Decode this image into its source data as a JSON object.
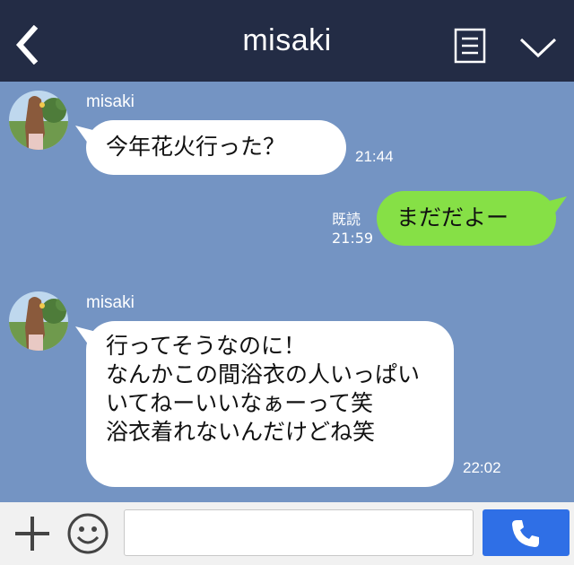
{
  "header": {
    "title": "misaki",
    "back_icon": "chevron-left-icon",
    "notes_icon": "note-icon",
    "menu_icon": "chevron-down-icon"
  },
  "messages": [
    {
      "direction": "in",
      "sender": "misaki",
      "text": "今年花火行った？",
      "time": "21:44"
    },
    {
      "direction": "out",
      "text": "まだだよー",
      "read_label": "既読",
      "time": "21:59"
    },
    {
      "direction": "in",
      "sender": "misaki",
      "text": "行ってそうなのに！\nなんかこの間浴衣の人いっぱいいてねーいいなぁーって笑\n浴衣着れないんだけどね笑",
      "time": "22:02"
    }
  ],
  "footer": {
    "input_placeholder": "",
    "plus_icon": "plus-icon",
    "emoji_icon": "smiley-icon",
    "call_icon": "phone-icon"
  },
  "colors": {
    "header": "#232c45",
    "chat_bg": "#7494c3",
    "bubble_out": "#86e046",
    "bubble_in": "#ffffff",
    "call_button": "#2f6fe6"
  }
}
